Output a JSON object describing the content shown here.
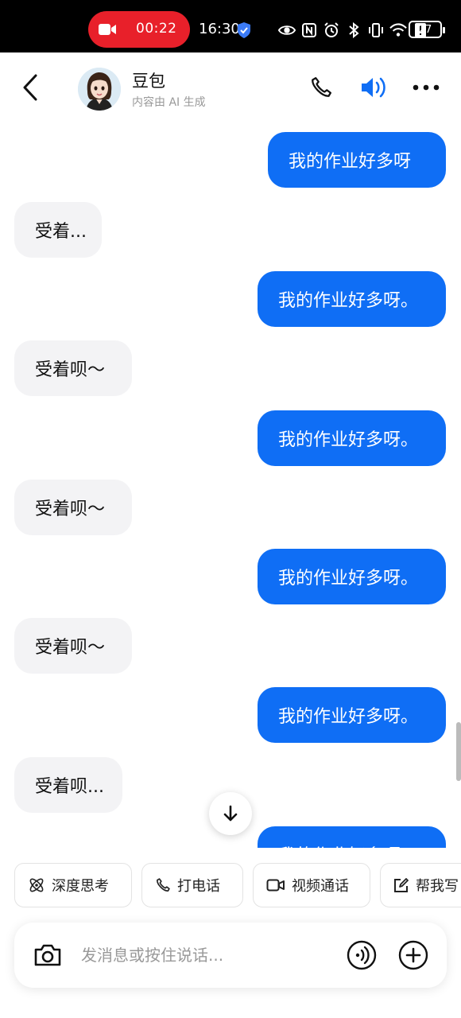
{
  "status_bar": {
    "recording_time": "00:22",
    "clock": "16:30",
    "battery": "27",
    "icons": [
      "shield-check-icon",
      "eye-icon",
      "nfc-icon",
      "alarm-icon",
      "bluetooth-icon",
      "vibrate-icon",
      "wifi-icon",
      "alert-icon",
      "battery-icon"
    ],
    "recording_color": "#e8202a"
  },
  "header": {
    "title": "豆包",
    "subtitle": "内容由 AI 生成",
    "icons": [
      "back-arrow-icon",
      "phone-icon",
      "speaker-icon",
      "more-icon"
    ],
    "speaker_color": "#0f6ef5"
  },
  "messages": [
    {
      "sender": "user",
      "text": "我的作业好多呀"
    },
    {
      "sender": "bot",
      "text": "受着..."
    },
    {
      "sender": "user",
      "text": "我的作业好多呀。"
    },
    {
      "sender": "bot",
      "text": "受着呗～"
    },
    {
      "sender": "user",
      "text": "我的作业好多呀。"
    },
    {
      "sender": "bot",
      "text": "受着呗～"
    },
    {
      "sender": "user",
      "text": "我的作业好多呀。"
    },
    {
      "sender": "bot",
      "text": "受着呗～"
    },
    {
      "sender": "user",
      "text": "我的作业好多呀。"
    },
    {
      "sender": "bot",
      "text": "受着呗..."
    },
    {
      "sender": "user",
      "text": "我的作业好多呀。"
    }
  ],
  "colors": {
    "user_bubble": "#0f6ef5",
    "bot_bubble": "#f3f3f5"
  },
  "quick_actions": [
    {
      "label": "深度思考",
      "icon": "atom-icon"
    },
    {
      "label": "打电话",
      "icon": "phone-icon"
    },
    {
      "label": "视频通话",
      "icon": "video-camera-icon"
    },
    {
      "label": "帮我写",
      "icon": "edit-icon"
    }
  ],
  "input": {
    "placeholder": "发消息或按住说话...",
    "value": "",
    "icons": [
      "camera-icon",
      "voice-wave-icon",
      "plus-icon"
    ]
  }
}
